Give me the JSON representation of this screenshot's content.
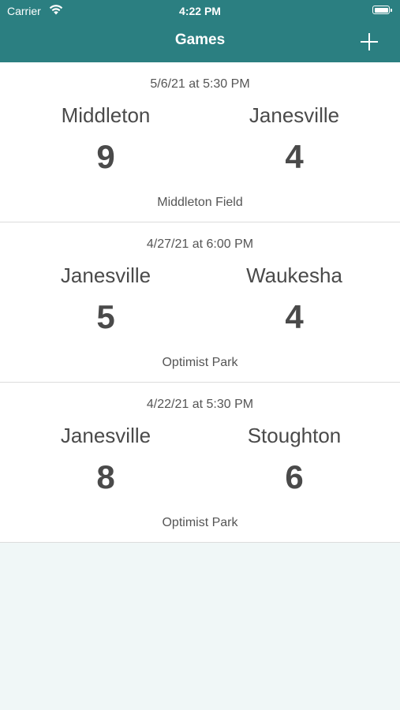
{
  "status_bar": {
    "carrier": "Carrier",
    "time": "4:22 PM"
  },
  "nav": {
    "title": "Games",
    "add_icon": "plus-icon"
  },
  "games": [
    {
      "date": "5/6/21 at 5:30 PM",
      "home_team": "Middleton",
      "away_team": "Janesville",
      "home_score": "9",
      "away_score": "4",
      "venue": "Middleton Field"
    },
    {
      "date": "4/27/21 at 6:00 PM",
      "home_team": "Janesville",
      "away_team": "Waukesha",
      "home_score": "5",
      "away_score": "4",
      "venue": "Optimist Park"
    },
    {
      "date": "4/22/21 at 5:30 PM",
      "home_team": "Janesville",
      "away_team": "Stoughton",
      "home_score": "8",
      "away_score": "6",
      "venue": "Optimist Park"
    }
  ],
  "colors": {
    "nav_background": "#2b7f81",
    "page_background": "#f0f7f7",
    "text": "#4a4a4a"
  }
}
